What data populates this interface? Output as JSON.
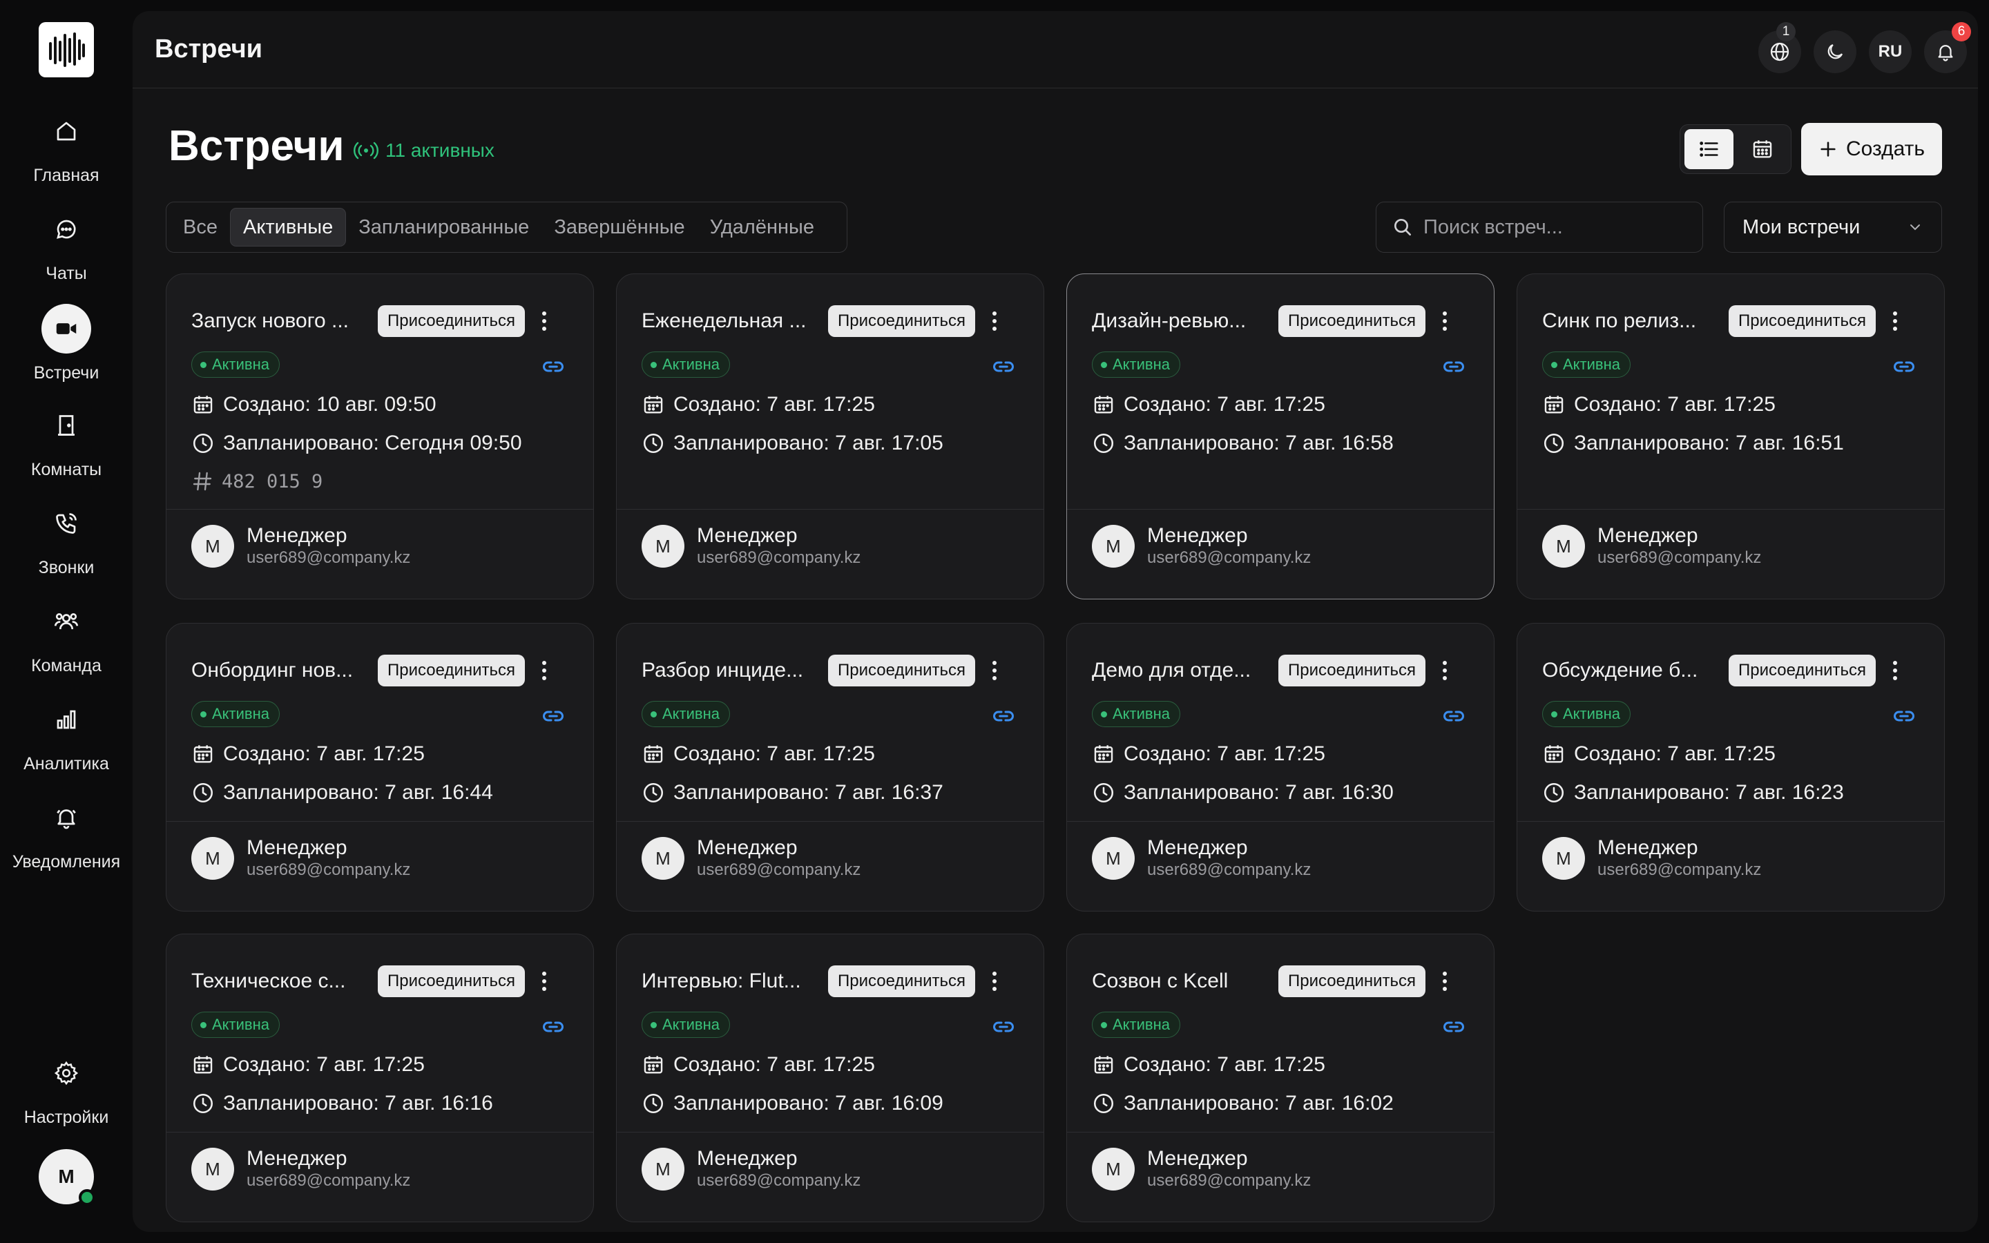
{
  "sidebar": {
    "items": [
      {
        "label": "Главная",
        "icon": "home-icon"
      },
      {
        "label": "Чаты",
        "icon": "chat-icon"
      },
      {
        "label": "Встречи",
        "icon": "video-camera-icon",
        "active": true
      },
      {
        "label": "Комнаты",
        "icon": "door-icon"
      },
      {
        "label": "Звонки",
        "icon": "phone-icon"
      },
      {
        "label": "Команда",
        "icon": "team-icon"
      },
      {
        "label": "Аналитика",
        "icon": "bar-chart-icon"
      },
      {
        "label": "Уведомления",
        "icon": "bell-icon"
      }
    ],
    "settings_label": "Настройки",
    "user_initial": "M"
  },
  "topbar": {
    "title": "Встречи",
    "globe_badge": "1",
    "language": "RU",
    "notifications_badge": "6"
  },
  "header": {
    "title": "Встречи",
    "active_count": "11 активных",
    "create_label": "Создать"
  },
  "filters": {
    "tabs": [
      "Все",
      "Активные",
      "Запланированные",
      "Завершённые",
      "Удалённые"
    ],
    "selected_tab": "Активные",
    "search_placeholder": "Поиск встреч...",
    "owner_filter": "Мои встречи"
  },
  "colors": {
    "accent_green": "#39c17a",
    "link_blue": "#3b8ef0",
    "badge_red": "#ef4444"
  },
  "meetings": [
    {
      "title": "Запуск нового ...",
      "join": "Присоединиться",
      "status": "Активна",
      "created": "Создано: 10 авг. 09:50",
      "scheduled": "Запланировано: Сегодня 09:50",
      "code": "482 015 9",
      "owner_initial": "M",
      "owner_name": "Менеджер",
      "owner_email": "user689@company.kz"
    },
    {
      "title": "Еженедельная ...",
      "join": "Присоединиться",
      "status": "Активна",
      "created": "Создано: 7 авг. 17:25",
      "scheduled": "Запланировано: 7 авг. 17:05",
      "owner_initial": "M",
      "owner_name": "Менеджер",
      "owner_email": "user689@company.kz"
    },
    {
      "title": "Дизайн-ревью...",
      "join": "Присоединиться",
      "status": "Активна",
      "created": "Создано: 7 авг. 17:25",
      "scheduled": "Запланировано: 7 авг. 16:58",
      "owner_initial": "M",
      "owner_name": "Менеджер",
      "owner_email": "user689@company.kz"
    },
    {
      "title": "Синк по релиз...",
      "join": "Присоединиться",
      "status": "Активна",
      "created": "Создано: 7 авг. 17:25",
      "scheduled": "Запланировано: 7 авг. 16:51",
      "owner_initial": "M",
      "owner_name": "Менеджер",
      "owner_email": "user689@company.kz"
    },
    {
      "title": "Онбординг нов...",
      "join": "Присоединиться",
      "status": "Активна",
      "created": "Создано: 7 авг. 17:25",
      "scheduled": "Запланировано: 7 авг. 16:44",
      "owner_initial": "M",
      "owner_name": "Менеджер",
      "owner_email": "user689@company.kz"
    },
    {
      "title": "Разбор инциде...",
      "join": "Присоединиться",
      "status": "Активна",
      "created": "Создано: 7 авг. 17:25",
      "scheduled": "Запланировано: 7 авг. 16:37",
      "owner_initial": "M",
      "owner_name": "Менеджер",
      "owner_email": "user689@company.kz"
    },
    {
      "title": "Демо для отде...",
      "join": "Присоединиться",
      "status": "Активна",
      "created": "Создано: 7 авг. 17:25",
      "scheduled": "Запланировано: 7 авг. 16:30",
      "owner_initial": "M",
      "owner_name": "Менеджер",
      "owner_email": "user689@company.kz"
    },
    {
      "title": "Обсуждение б...",
      "join": "Присоединиться",
      "status": "Активна",
      "created": "Создано: 7 авг. 17:25",
      "scheduled": "Запланировано: 7 авг. 16:23",
      "owner_initial": "M",
      "owner_name": "Менеджер",
      "owner_email": "user689@company.kz"
    },
    {
      "title": "Техническое с...",
      "join": "Присоединиться",
      "status": "Активна",
      "created": "Создано: 7 авг. 17:25",
      "scheduled": "Запланировано: 7 авг. 16:16",
      "owner_initial": "M",
      "owner_name": "Менеджер",
      "owner_email": "user689@company.kz"
    },
    {
      "title": "Интервью: Flut...",
      "join": "Присоединиться",
      "status": "Активна",
      "created": "Создано: 7 авг. 17:25",
      "scheduled": "Запланировано: 7 авг. 16:09",
      "owner_initial": "M",
      "owner_name": "Менеджер",
      "owner_email": "user689@company.kz"
    },
    {
      "title": "Созвон с Kcell",
      "join": "Присоединиться",
      "status": "Активна",
      "created": "Создано: 7 авг. 17:25",
      "scheduled": "Запланировано: 7 авг. 16:02",
      "owner_initial": "M",
      "owner_name": "Менеджер",
      "owner_email": "user689@company.kz"
    }
  ]
}
